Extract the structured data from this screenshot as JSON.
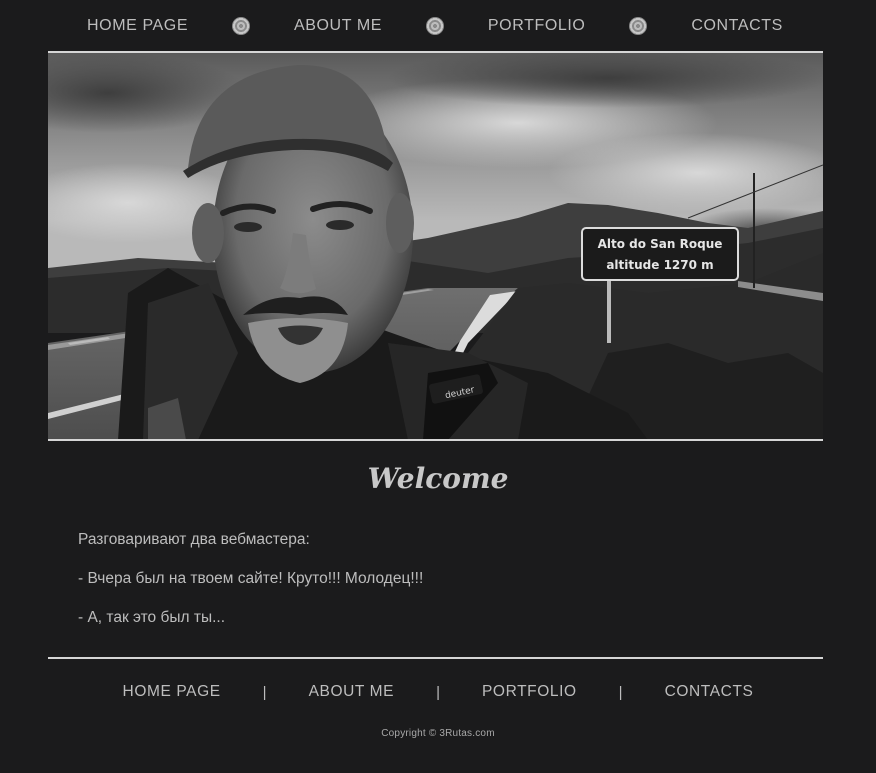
{
  "top_nav": {
    "items": [
      {
        "label": "HOME PAGE"
      },
      {
        "label": "ABOUT ME"
      },
      {
        "label": "PORTFOLIO"
      },
      {
        "label": "CONTACTS"
      }
    ]
  },
  "hero": {
    "sign_line1": "Alto do San Roque",
    "sign_line2": "altitude 1270 m",
    "backpack_brand": "deuter"
  },
  "main": {
    "heading": "Welcome",
    "paragraphs": [
      "Разговаривают два вебмастера:",
      "- Вчера был на твоем сайте! Круто!!! Молодец!!!",
      "- А, так это был ты..."
    ]
  },
  "footer_nav": {
    "items": [
      {
        "label": "HOME PAGE"
      },
      {
        "label": "ABOUT ME"
      },
      {
        "label": "PORTFOLIO"
      },
      {
        "label": "CONTACTS"
      }
    ],
    "separator": "|"
  },
  "footer": {
    "copyright": "Copyright © 3Rutas.com"
  }
}
